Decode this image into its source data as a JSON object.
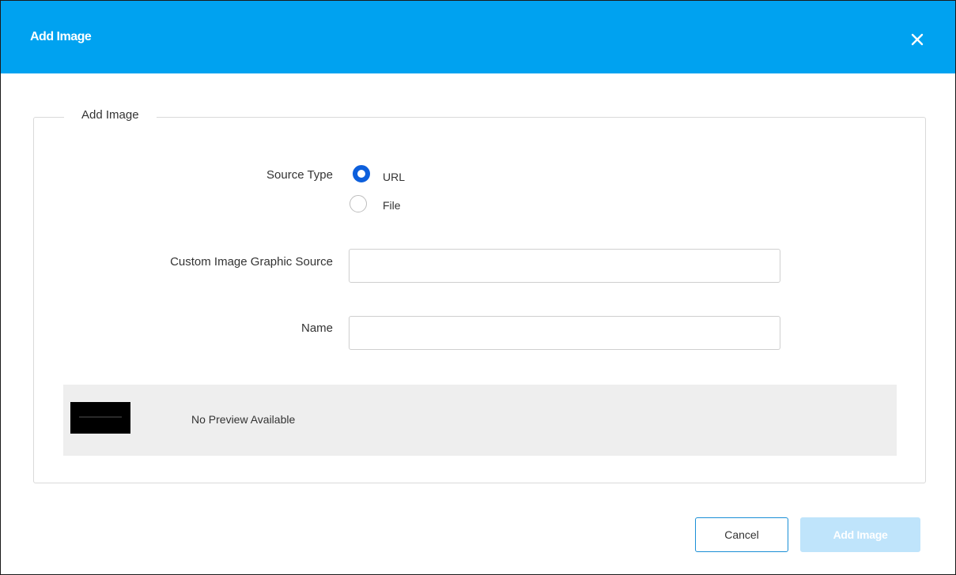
{
  "dialog": {
    "title": "Add Image"
  },
  "fieldset": {
    "legend": "Add Image"
  },
  "source_type": {
    "label": "Source Type",
    "options": [
      {
        "label": "URL",
        "selected": true
      },
      {
        "label": "File",
        "selected": false
      }
    ]
  },
  "graphic_source": {
    "label": "Custom Image Graphic Source",
    "value": "",
    "placeholder": ""
  },
  "name_field": {
    "label": "Name",
    "value": "",
    "placeholder": ""
  },
  "preview": {
    "message": "No Preview Available"
  },
  "buttons": {
    "cancel": "Cancel",
    "add": "Add Image"
  },
  "colors": {
    "header": "#00a2f0",
    "radio_selected": "#0d5fdc",
    "add_button_disabled": "#bfe4fb"
  }
}
